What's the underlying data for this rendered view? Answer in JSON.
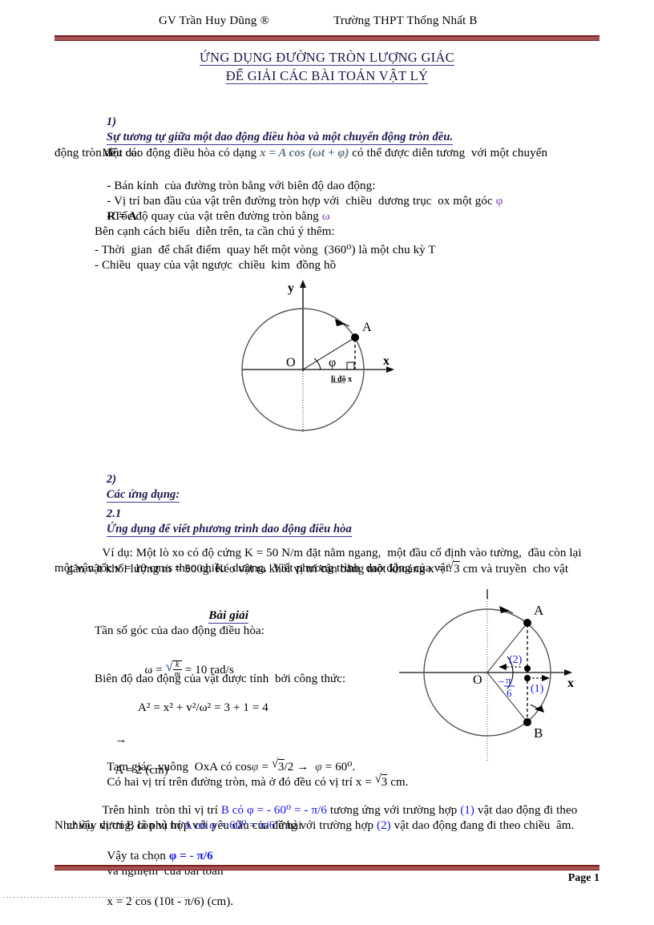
{
  "header": {
    "left": "GV Trần Huy Dũng ®",
    "right": "Trường THPT Thống  Nhất B"
  },
  "title": {
    "line1": "ỨNG DỤNG ĐƯỜNG TRÒN LƯỢNG GIÁC",
    "line2": "ĐỂ GIẢI CÁC BÀI TOÁN VẬT LÝ"
  },
  "section1": {
    "number": "1)",
    "heading": "Sự tương tự giữa một dao động điều hòa và một chuyển động tròn đều.",
    "intro_a": "Một dao động điều hòa có dạng ",
    "intro_formula": "x = A cos (ωt + φ)",
    "intro_b": " có thể được diễn tương  với một chuyển",
    "intro_c": "động tròn đều có:",
    "bullets": [
      {
        "text": "- Bán kính  của đường tròn bằng với biên độ dao động:",
        "trail": "R = A"
      },
      {
        "text": "- Vị trí ban đầu của vật trên đường tròn hợp với  chiều  dương trục  ox một góc ",
        "sym": "φ"
      },
      {
        "text": "- Tốc độ quay của vật trên đường tròn bằng ",
        "sym": "ω"
      }
    ],
    "note_intro": "Bên cạnh cách biểu  diễn trên, ta cần chú ý thêm:",
    "note_lines": [
      "- Thời  gian  để chất điểm  quay hết một vòng  (360⁰) là một chu kỳ T",
      "- Chiều  quay của vật ngược  chiều  kim  đồng hồ"
    ]
  },
  "figure1": {
    "axis_y": "y",
    "axis_x": "x",
    "origin": "O",
    "angle": "φ",
    "point_a": "A",
    "caption": "li độ x"
  },
  "section2": {
    "number": "2)",
    "heading": "Các ứng dụng:",
    "sub_number": "2.1",
    "sub_heading": "Ứng dụng để viết phương trình dao động điều hòa",
    "example_line1": "Ví dụ: Một lò xo có độ cứng K = 50 N/m đặt nằm ngang,  một đầu cố định vào tường,  đầu còn lại",
    "example_line2a": "gắn vật khối lượng m = 500g. Kéo vật ra khỏi vị trí cân bằng một khoảng x = ",
    "example_line2_rad": "3",
    "example_line2b": " cm và truyền  cho vật",
    "example_line3": "một vận tốc v = 10 cm/s theo chiều  dương.  Viết phương trình  dao động của vật.",
    "solution_label": "Bài giải",
    "step1_label": "Tần số góc của dao động điều hòa:",
    "step1_formula_lhs": "ω = ",
    "step1_num": "k",
    "step1_den": "m",
    "step1_rhs": " = 10 rad/s",
    "step2_label": "Biên độ dao động của vật được tính  bởi công thức:",
    "step2_formula": "A² = x² + v²/ω² = 3 + 1 = 4",
    "step2_result_arrow": "→",
    "step2_result": "A = 2 (cm)",
    "step3a": "Tam giác  vuông  OxA có cos",
    "step3_sym": "φ",
    "step3b": " = ",
    "step3_rad": "3",
    "step3c": "/2 →  ",
    "step3_sym2": "φ",
    "step3d": " = 60⁰.",
    "step4a": "Có hai vị trí trên đường tròn, mà ở đó đều có vị trí x = ",
    "step4_rad": "3",
    "step4b": " cm.",
    "concl1a": "Trên hình  tròn thì vị trí ",
    "concl1_blueA": "B có φ = - 60⁰ = - π/6",
    "concl1b": " tương ứng với trường hợp ",
    "concl1_blueB": "(1)",
    "concl1c": " vật dao động đi theo",
    "concl2a": "chiều  dương, còn vị trí ",
    "concl2_blueA": "A có φ = 60⁰ = π/6",
    "concl2b": " ứng với trường hợp ",
    "concl2_blueB": "(2)",
    "concl2c": " vật dao động đang đi theo chiều  âm.",
    "concl3": "Như vậy vị trí B là phù hợp với yêu cầu của đề bài.",
    "choose_a": "Vậy ta chọn ",
    "choose_blue": "φ = - π/6",
    "final_a": "và nghiệm  của bài toán",
    "final_b": "x = 2 cos (10t - π/6) (cm)."
  },
  "figure2": {
    "axis_x": "x",
    "origin": "O",
    "point_a": "A",
    "point_b": "B",
    "label1": "(1)",
    "label2": "(2)",
    "angle_num": "π",
    "angle_den": "6",
    "angle_sign": "−"
  },
  "footer": {
    "page": "Page 1",
    "dots": "......................................................."
  },
  "colors": {
    "rule": "#7b2020",
    "title": "#17174f",
    "blue": "#1414e6",
    "violet": "#7a3fb0",
    "formula": "#5a6f86"
  }
}
